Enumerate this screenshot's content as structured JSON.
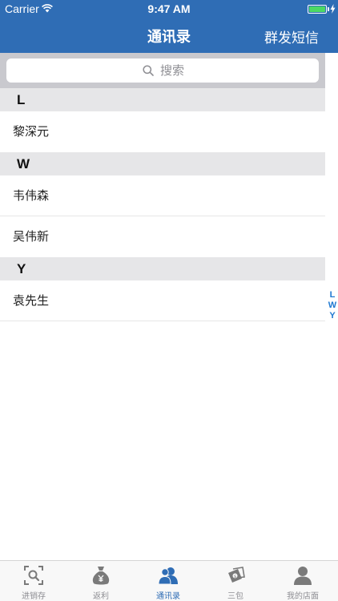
{
  "status_bar": {
    "carrier": "Carrier",
    "time": "9:47 AM"
  },
  "nav": {
    "title": "通讯录",
    "right_button": "群发短信"
  },
  "search": {
    "placeholder": "搜索"
  },
  "sections": [
    {
      "letter": "L",
      "contacts": [
        "黎深元"
      ]
    },
    {
      "letter": "W",
      "contacts": [
        "韦伟森",
        "吴伟新"
      ]
    },
    {
      "letter": "Y",
      "contacts": [
        "袁先生"
      ]
    }
  ],
  "index": [
    "L",
    "W",
    "Y"
  ],
  "tabs": [
    {
      "label": "进销存",
      "icon": "scan-search-icon"
    },
    {
      "label": "返利",
      "icon": "money-bag-icon"
    },
    {
      "label": "通讯录",
      "icon": "contacts-icon",
      "active": true
    },
    {
      "label": "三包",
      "icon": "gift-money-icon"
    },
    {
      "label": "我的店面",
      "icon": "user-icon"
    }
  ],
  "colors": {
    "primary": "#2f6db5",
    "section_bg": "#e6e6e8",
    "search_bg": "#c9c9ce",
    "index_text": "#1f78d1",
    "battery": "#4cd964"
  }
}
